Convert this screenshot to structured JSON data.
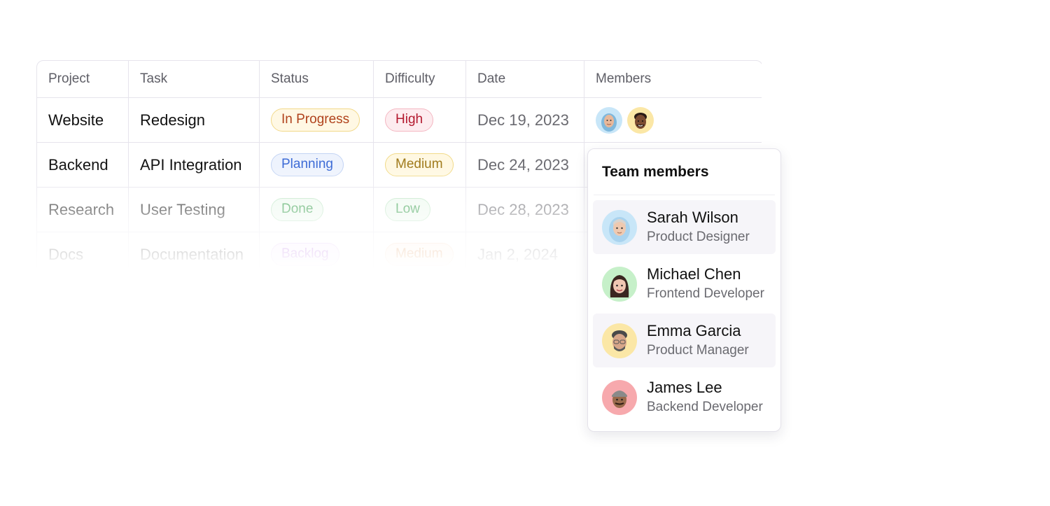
{
  "table": {
    "headers": [
      "Project",
      "Task",
      "Status",
      "Difficulty",
      "Date",
      "Members"
    ],
    "rows": [
      {
        "project": "Website",
        "task": "Redesign",
        "status": "In Progress",
        "difficulty": "High",
        "date": "Dec 19, 2023"
      },
      {
        "project": "Backend",
        "task": "API Integration",
        "status": "Planning",
        "difficulty": "Medium",
        "date": "Dec 24, 2023"
      },
      {
        "project": "Research",
        "task": "User Testing",
        "status": "Done",
        "difficulty": "Low",
        "date": "Dec 28, 2023"
      },
      {
        "project": "Docs",
        "task": "Documentation",
        "status": "Backlog",
        "difficulty": "Medium",
        "date": "Jan 2, 2024"
      }
    ]
  },
  "popover": {
    "title": "Team members",
    "members": [
      {
        "name": "Sarah Wilson",
        "role": "Product Designer"
      },
      {
        "name": "Michael Chen",
        "role": "Frontend Developer"
      },
      {
        "name": "Emma Garcia",
        "role": "Product Manager"
      },
      {
        "name": "James Lee",
        "role": "Backend Developer"
      }
    ]
  },
  "colors": {
    "avatar_bg_blue": "#c8e6f8",
    "avatar_bg_yellow": "#fbe7a6",
    "avatar_bg_green": "#c6f0c9",
    "avatar_bg_pink": "#f7a9ad",
    "highlight_row": "#f6f5f9"
  },
  "icons": {
    "member_avatar": "memoji-avatar-icon"
  }
}
